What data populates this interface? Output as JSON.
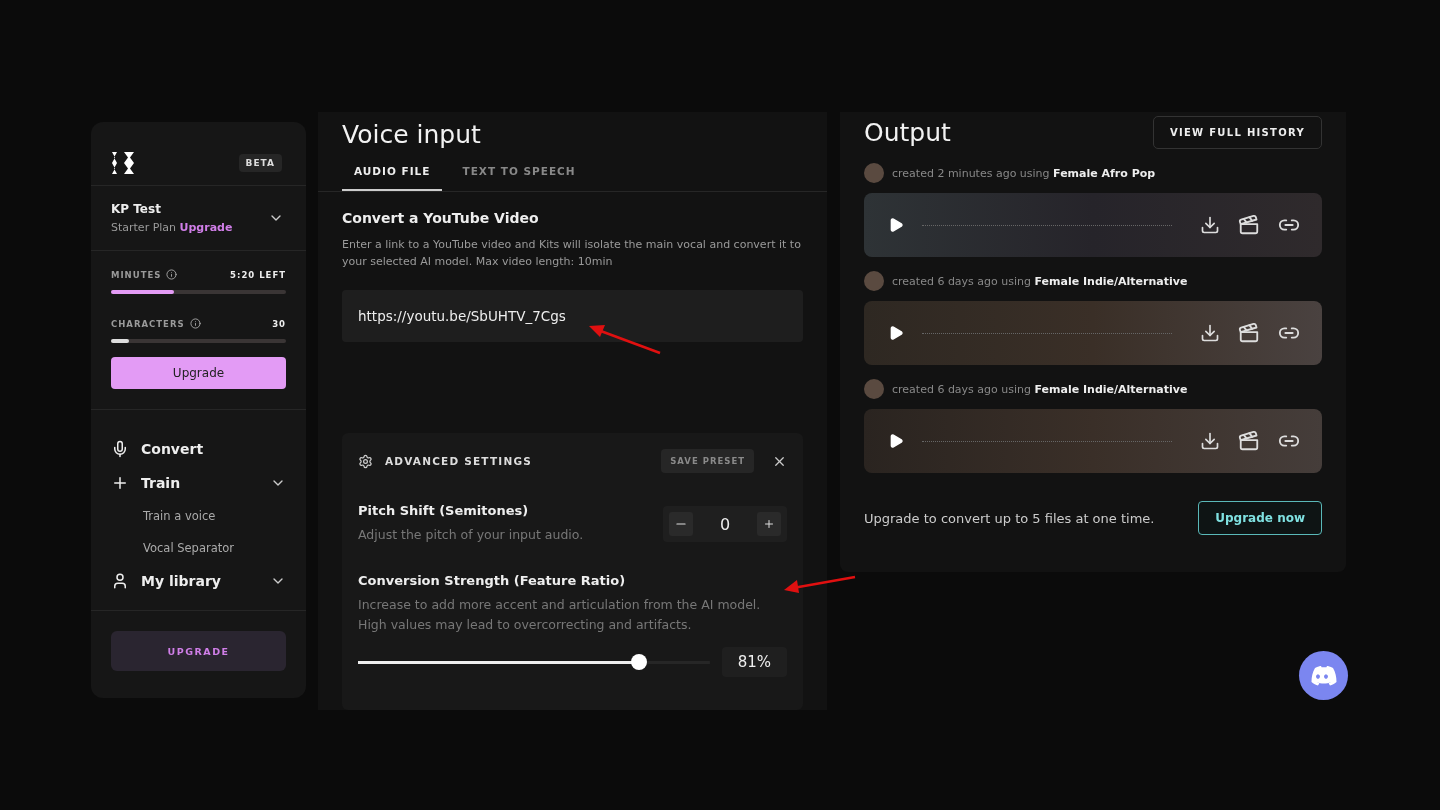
{
  "sidebar": {
    "badge": "BETA",
    "account": {
      "name": "KP Test",
      "plan": "Starter Plan",
      "upgrade_link": "Upgrade"
    },
    "usage": [
      {
        "label": "MINUTES",
        "value": "5:20 LEFT",
        "level": 0.36
      },
      {
        "label": "CHARACTERS",
        "value": "30",
        "level": 0.1
      }
    ],
    "upgrade_button": "Upgrade",
    "nav": [
      {
        "label": "Convert",
        "expandable": false
      },
      {
        "label": "Train",
        "expandable": true,
        "children": [
          "Train a voice",
          "Vocal Separator"
        ]
      },
      {
        "label": "My library",
        "expandable": true
      }
    ],
    "footer_button": "UPGRADE"
  },
  "voice_input": {
    "title": "Voice input",
    "tabs": [
      {
        "label": "AUDIO FILE",
        "selected": true
      },
      {
        "label": "TEXT TO SPEECH",
        "selected": false
      }
    ],
    "section_title": "Convert a YouTube Video",
    "description": "Enter a link to a YouTube video and Kits will isolate the main vocal and convert it to your selected AI model. Max video length: 10min",
    "url_field": {
      "value": "https://youtu.be/SbUHTV_7Cgs"
    },
    "advanced": {
      "title": "ADVANCED SETTINGS",
      "save_preset": {
        "label": "SAVE PRESET",
        "disabled": true
      },
      "pitch": {
        "label": "Pitch Shift (Semitones)",
        "description": "Adjust the pitch of your input audio.",
        "value": "0"
      },
      "strength": {
        "label": "Conversion Strength (Feature Ratio)",
        "description": "Increase to add more accent and articulation from the AI model. High values may lead to overcorrecting and artifacts.",
        "level": 0.8,
        "reading": "81%"
      }
    }
  },
  "output": {
    "title": "Output",
    "history_button": "VIEW FULL HISTORY",
    "items": [
      {
        "text": "created 2 minutes ago using **Female Afro Pop**"
      },
      {
        "text": "created 6 days ago using **Female Indie/Alternative**"
      },
      {
        "text": "created 6 days ago using **Female Indie/Alternative**"
      }
    ],
    "note": "Upgrade to convert up to 5 files at one time.",
    "upgrade_button": "Upgrade now"
  }
}
